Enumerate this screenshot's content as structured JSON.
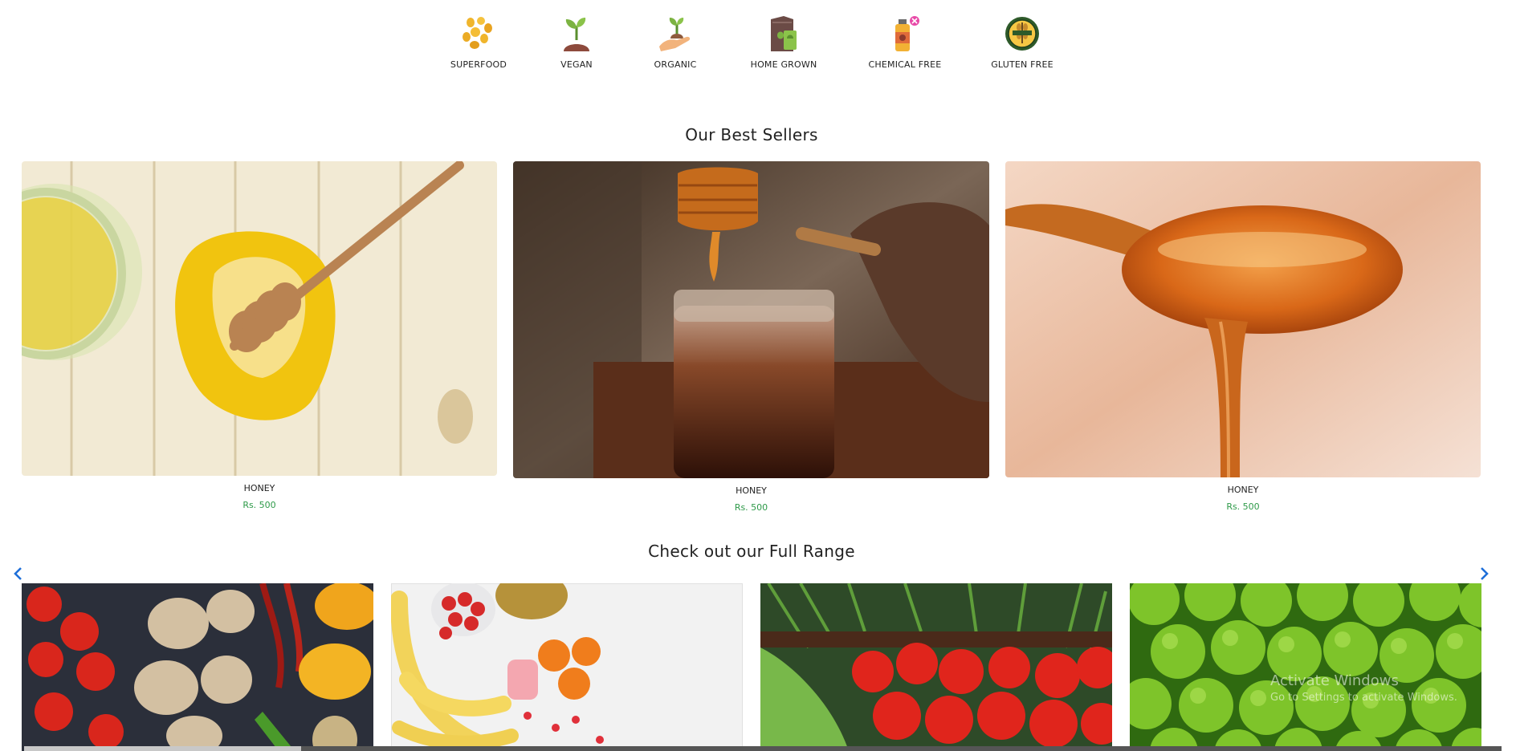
{
  "features": [
    {
      "label": "SUPERFOOD",
      "icon": "superfood-seeds-icon"
    },
    {
      "label": "VEGAN",
      "icon": "vegan-sprout-icon"
    },
    {
      "label": "ORGANIC",
      "icon": "organic-hand-sprout-icon"
    },
    {
      "label": "HOME GROWN",
      "icon": "home-grown-bag-icon"
    },
    {
      "label": "CHEMICAL FREE",
      "icon": "chemical-free-bottle-icon"
    },
    {
      "label": "GLUTEN FREE",
      "icon": "gluten-free-badge-icon"
    }
  ],
  "best_sellers": {
    "title": "Our Best Sellers",
    "items": [
      {
        "name": "HONEY",
        "price": "Rs. 500",
        "image": "honey-jar-dipper-on-wood"
      },
      {
        "name": "HONEY",
        "price": "Rs. 500",
        "image": "honey-dipper-over-jar"
      },
      {
        "name": "HONEY",
        "price": "Rs. 500",
        "image": "honey-dripping-spoon"
      }
    ]
  },
  "full_range": {
    "title": "Check out our Full Range",
    "tiles": [
      {
        "image": "vegetables-tomatoes-mushrooms-peppers"
      },
      {
        "image": "fruits-bananas-strawberries-pineapple"
      },
      {
        "image": "tomatoes-and-greens"
      },
      {
        "image": "green-apples"
      }
    ],
    "prev_icon": "chevron-left-icon",
    "next_icon": "chevron-right-icon"
  },
  "watermark": {
    "line1": "Activate Windows",
    "line2": "Go to Settings to activate Windows."
  },
  "colors": {
    "price": "#2e9a49",
    "arrow": "#1e6fd9",
    "title": "#222222"
  }
}
